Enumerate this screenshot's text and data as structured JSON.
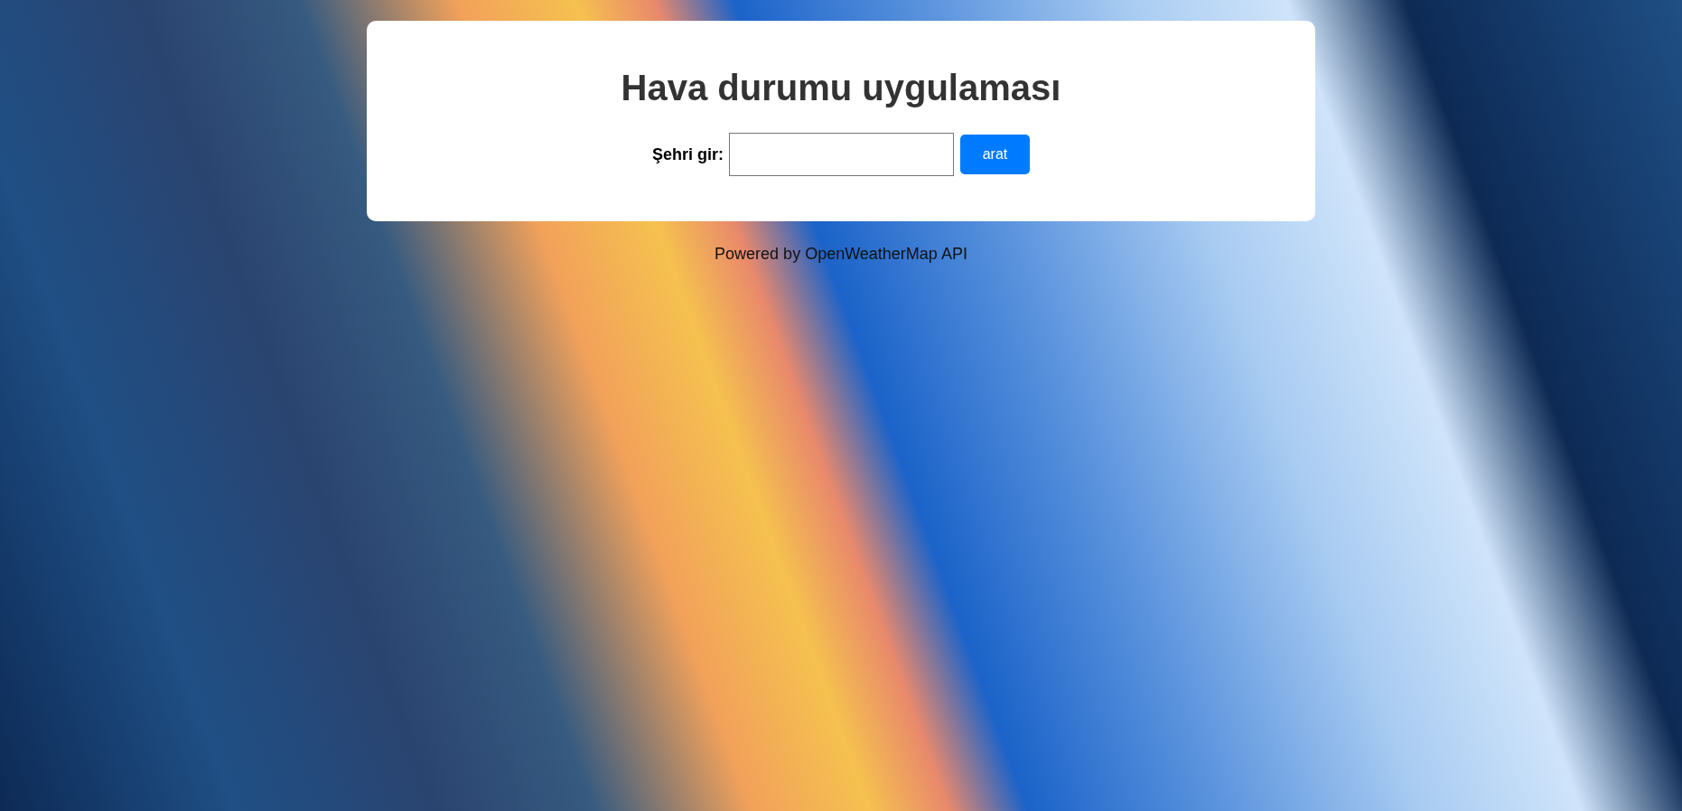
{
  "app": {
    "title": "Hava durumu uygulaması",
    "city_label": "Şehri gir:",
    "search_button": "arat"
  },
  "footer": "Powered by OpenWeatherMap API"
}
